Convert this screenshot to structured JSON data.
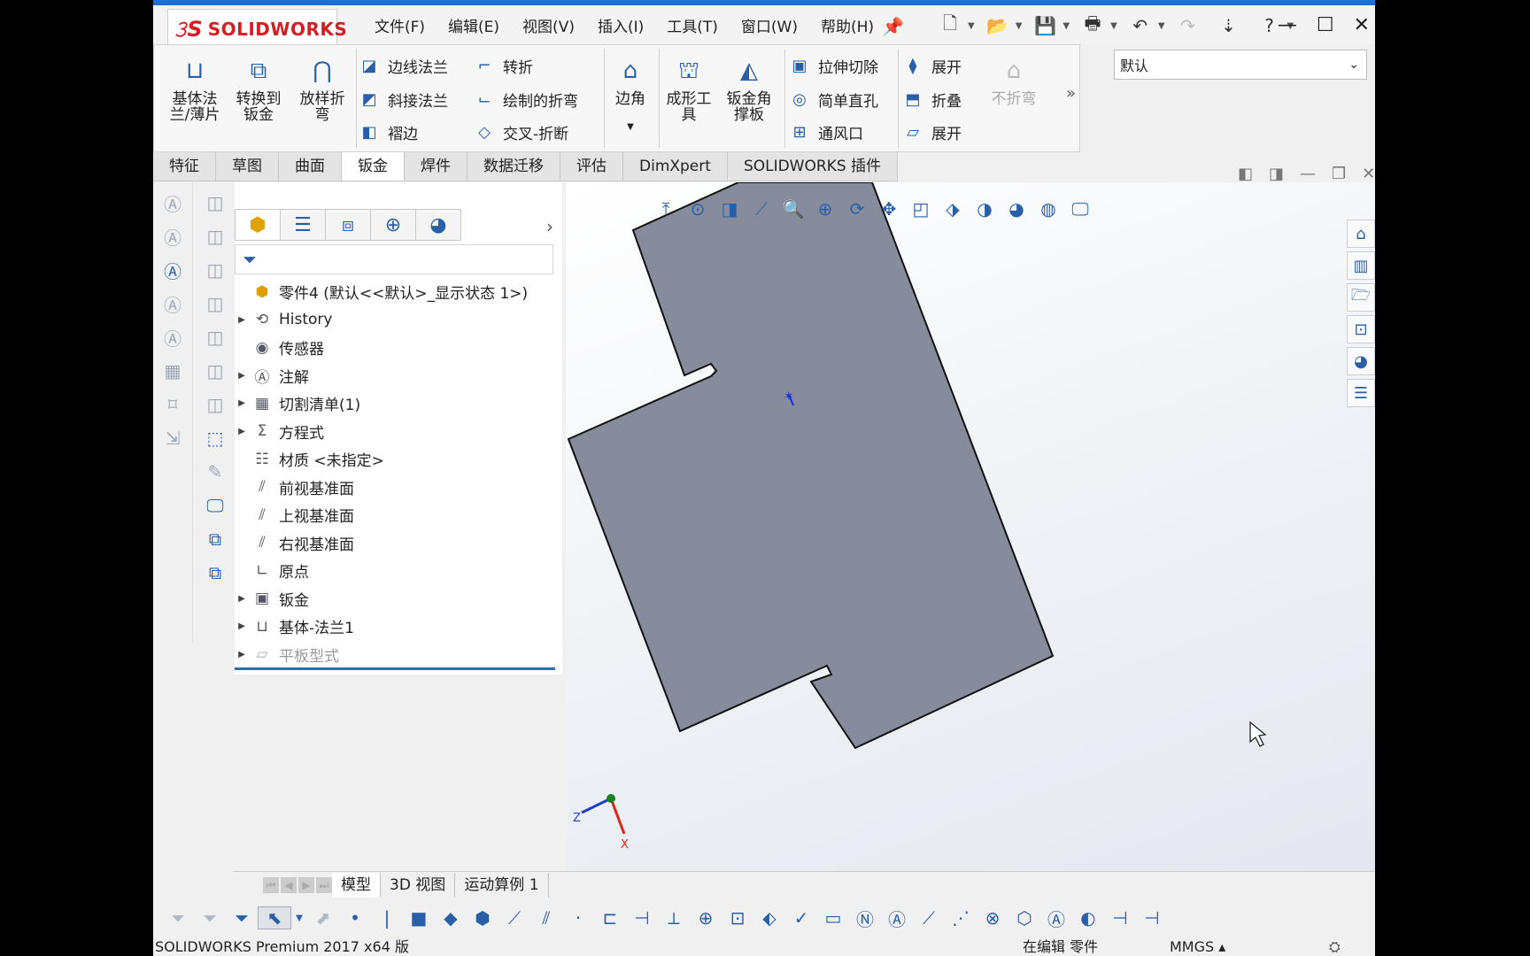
{
  "app": {
    "logo_ds": "𝟹S",
    "logo_text": "SOLIDWORKS"
  },
  "menu": [
    "文件(F)",
    "编辑(E)",
    "视图(V)",
    "插入(I)",
    "工具(T)",
    "窗口(W)",
    "帮助(H)"
  ],
  "ribbon": {
    "base_flange": "基体法\n兰/薄片",
    "convert_to_sheet": "转换到\n钣金",
    "lofted_bend": "放样折\n弯",
    "edge_flange": "边线法兰",
    "miter_flange": "斜接法兰",
    "hem": "褶边",
    "jog": "转折",
    "sketched_bend": "绘制的折弯",
    "cross_break": "交叉-折断",
    "corners": "边角",
    "forming_tool": "成形工\n具",
    "gusset": "钣金角\n撑板",
    "extruded_cut": "拉伸切除",
    "simple_hole": "简单直孔",
    "vent": "通风口",
    "unfold": "展开",
    "fold": "折叠",
    "flatten": "展开",
    "no_bends": "不折弯"
  },
  "configuration": "默认",
  "tabs": [
    "特征",
    "草图",
    "曲面",
    "钣金",
    "焊件",
    "数据迁移",
    "评估",
    "DimXpert",
    "SOLIDWORKS 插件"
  ],
  "active_tab": "钣金",
  "tree": {
    "root": "零件4 (默认<<默认>_显示状态 1>)",
    "items": [
      {
        "label": "History",
        "icon": "history-icon"
      },
      {
        "label": "传感器",
        "icon": "sensor-icon"
      },
      {
        "label": "注解",
        "icon": "annotation-icon"
      },
      {
        "label": "切割清单(1)",
        "icon": "cutlist-icon"
      },
      {
        "label": "方程式",
        "icon": "equation-icon"
      },
      {
        "label": "材质 <未指定>",
        "icon": "material-icon"
      },
      {
        "label": "前视基准面",
        "icon": "plane-icon"
      },
      {
        "label": "上视基准面",
        "icon": "plane-icon"
      },
      {
        "label": "右视基准面",
        "icon": "plane-icon"
      },
      {
        "label": "原点",
        "icon": "origin-icon"
      },
      {
        "label": "钣金",
        "icon": "sheetmetal-icon"
      },
      {
        "label": "基体-法兰1",
        "icon": "base-flange-icon"
      },
      {
        "label": "平板型式",
        "icon": "flat-pattern-icon"
      }
    ]
  },
  "model_tabs": [
    "模型",
    "3D 视图",
    "运动算例 1"
  ],
  "active_model_tab": "模型",
  "status": {
    "product": "SOLIDWORKS Premium 2017 x64 版",
    "mode": "在编辑 零件",
    "units": "MMGS ▴"
  },
  "triad": {
    "x": "X",
    "z": "Z"
  },
  "colors": {
    "part_face": "#868c9c",
    "title_accent": "#1c6fd6",
    "brand": "#d41f26"
  }
}
